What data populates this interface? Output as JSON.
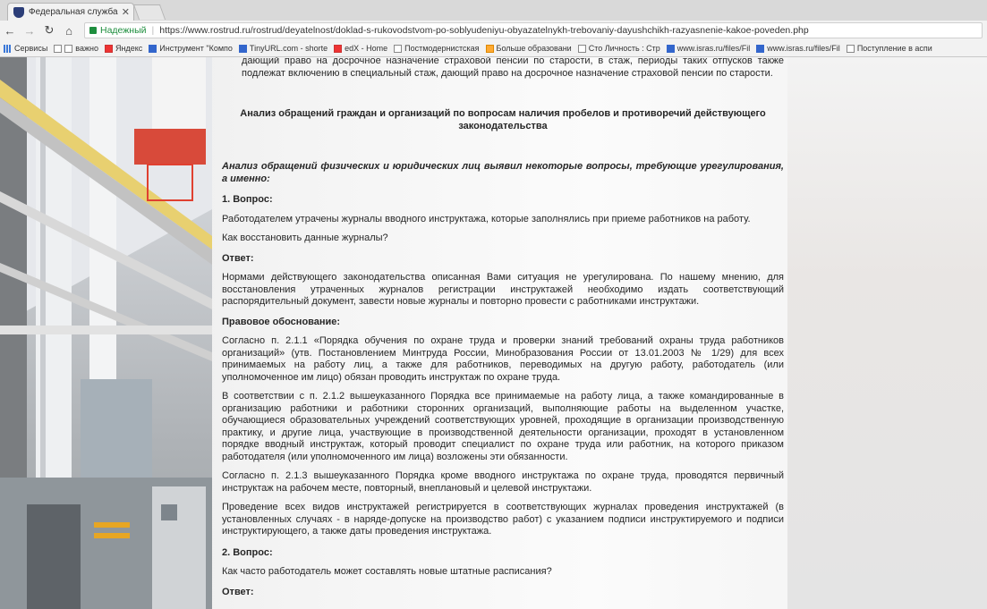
{
  "browser": {
    "tab_title": "Федеральная служба по",
    "secure_label": "Надежный",
    "url": "https://www.rostrud.ru/rostrud/deyatelnost/doklad-s-rukovodstvom-po-soblyudeniyu-obyazatelnykh-trebovaniy-dayushchikh-razyasnenie-kakoe-poveden.php",
    "bookmarks": [
      "Сервисы",
      "важно",
      "Яндекс",
      "Инструмент \"Компо",
      "TinyURL.com - shorte",
      "edX - Home",
      "Постмодернистская",
      "Больше образовани",
      "Сто Личность : Стр",
      "www.isras.ru/files/Fil",
      "www.isras.ru/files/Fil",
      "Поступление в аспи"
    ]
  },
  "article": {
    "top_fragment": "дающий право на досрочное назначение страховой пенсии по старости, в стаж, периоды таких отпусков также подлежат включению в специальный стаж, дающий право на досрочное назначение страховой пенсии по старости.",
    "section_heading": "Анализ обращений граждан и организаций по вопросам наличия пробелов и противоречий действующего законодательства",
    "intro": "Анализ обращений физических и юридических лиц выявил некоторые вопросы, требующие урегулирования, а именно:",
    "q1_label": "1. Вопрос:",
    "q1_text": "Работодателем утрачены журналы вводного инструктажа, которые заполнялись при приеме работников на работу.",
    "q1_followup": "Как восстановить данные журналы?",
    "answer_label": "Ответ:",
    "a1_text": "Нормами действующего законодательства описанная Вами ситуация не урегулирована. По нашему мнению, для восстановления утраченных журналов регистрации инструктажей необходимо издать соответствующий распорядительный документ, завести новые журналы и повторно провести с работниками инструктажи.",
    "legal_label": "Правовое обоснование:",
    "legal_p1": "Согласно п. 2.1.1 «Порядка обучения по охране труда и проверки знаний требований охраны труда работников организаций» (утв. Постановлением Минтруда России, Минобразования России от 13.01.2003 № 1/29) для всех принимаемых на работу лиц, а также для работников, переводимых на другую работу, работодатель (или уполномоченное им лицо) обязан проводить инструктаж по охране труда.",
    "legal_p2": "В соответствии с п. 2.1.2 вышеуказанного Порядка все принимаемые на работу лица, а также командированные в организацию работники и работники сторонних организаций, выполняющие работы на выделенном участке, обучающиеся образовательных учреждений соответствующих уровней, проходящие в организации производственную практику, и другие лица, участвующие в производственной деятельности организации, проходят в установленном порядке вводный инструктаж, который проводит специалист по охране труда или работник, на которого приказом работодателя (или уполномоченного им лица) возложены эти обязанности.",
    "legal_p3": "Согласно п. 2.1.3 вышеуказанного Порядка кроме вводного инструктажа по охране труда, проводятся первичный инструктаж на рабочем месте, повторный, внеплановый и целевой инструктажи.",
    "legal_p4": "Проведение всех видов инструктажей регистрируется в соответствующих журналах проведения инструктажей (в установленных случаях - в наряде-допуске на производство работ) с указанием подписи инструктируемого и подписи инструктирующего, а также даты проведения инструктажа.",
    "q2_label": "2. Вопрос:",
    "q2_text": "Как часто работодатель может составлять новые штатные расписания?",
    "answer2_label": "Ответ:"
  }
}
